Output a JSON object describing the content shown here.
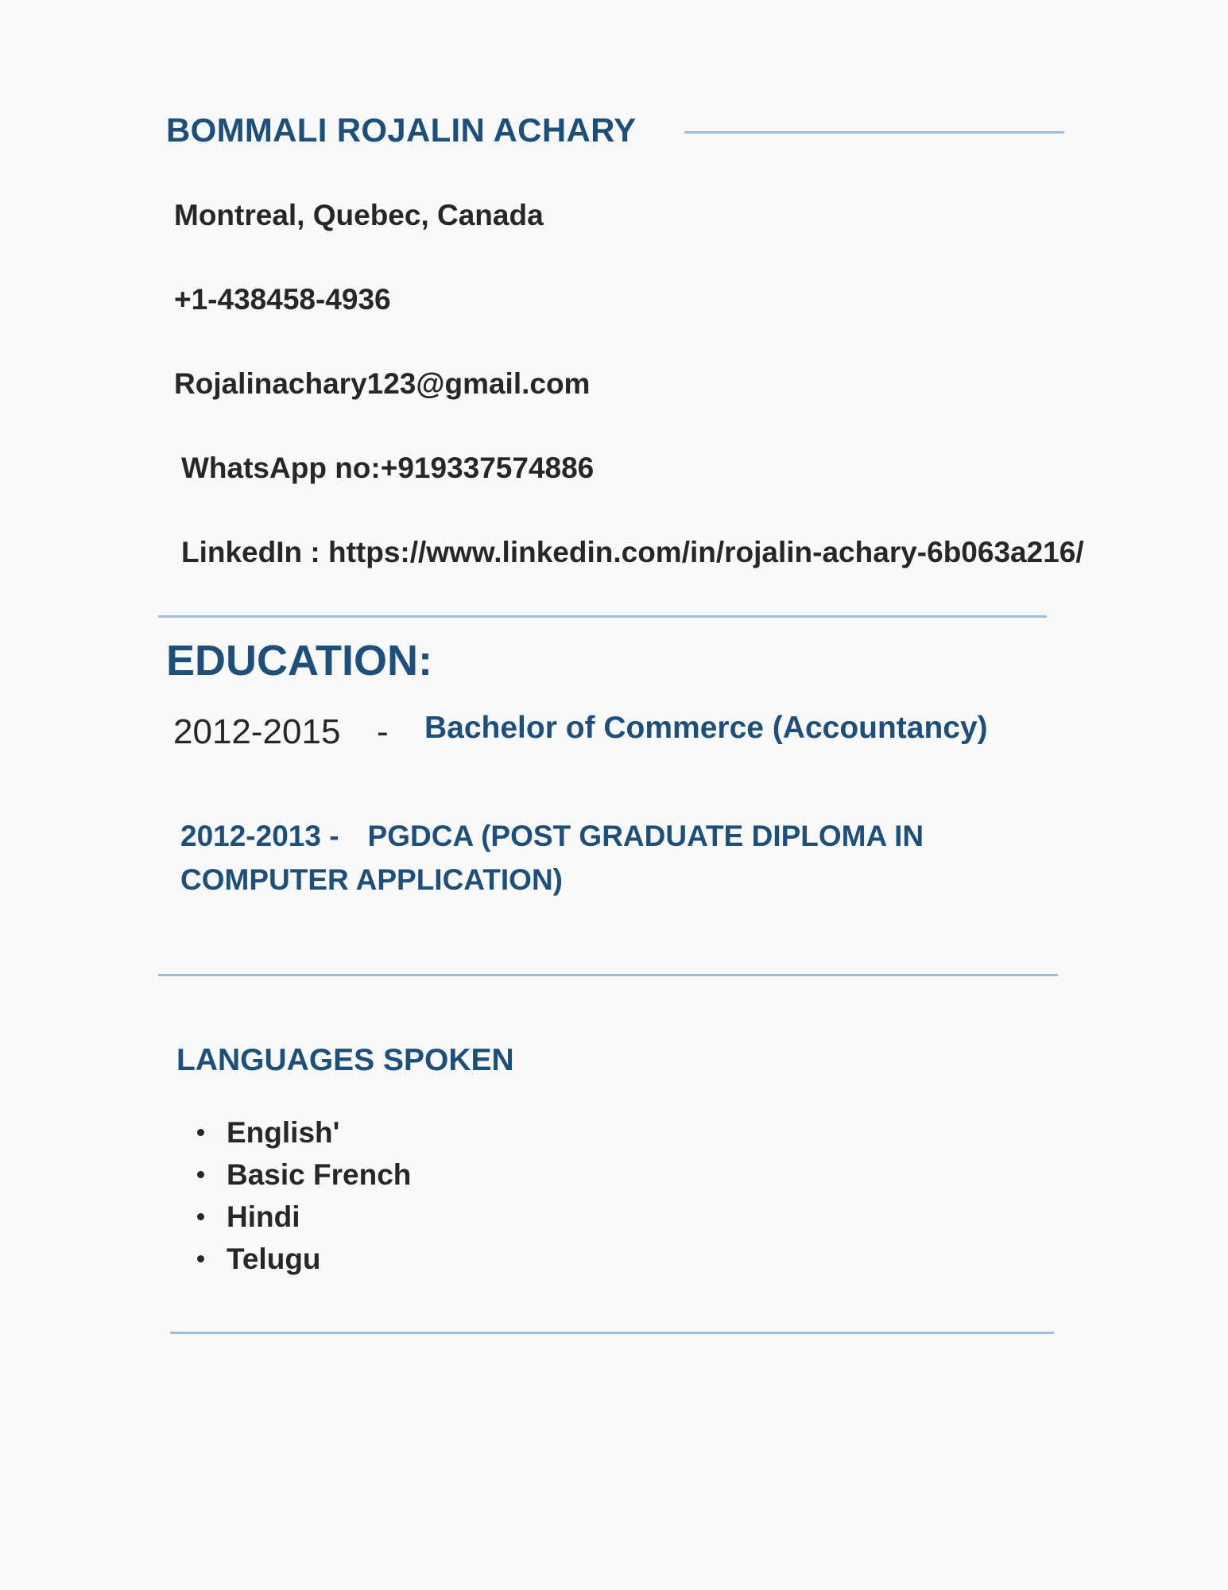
{
  "header": {
    "name": "BOMMALI ROJALIN ACHARY"
  },
  "contact": {
    "location": "Montreal, Quebec, Canada",
    "phone": "+1-438458-4936",
    "email": "Rojalinachary123@gmail.com",
    "whatsapp": "WhatsApp no:+919337574886",
    "linkedin": "LinkedIn : https://www.linkedin.com/in/rojalin-achary-6b063a216/"
  },
  "education": {
    "heading": "EDUCATION:",
    "items": [
      {
        "years": "2012-2015",
        "separator": "-",
        "degree": "Bachelor of Commerce (Accountancy)"
      },
      {
        "years": "2012-2013 -",
        "degree": "PGDCA (POST GRADUATE DIPLOMA IN COMPUTER APPLICATION)"
      }
    ]
  },
  "languages": {
    "heading": "LANGUAGES SPOKEN",
    "items": [
      "English'",
      "Basic French",
      "Hindi",
      "Telugu"
    ]
  },
  "colors": {
    "accent": "#1d4f7c",
    "rule": "#9ebedc",
    "text": "#272727",
    "background": "#f9f9f9"
  }
}
